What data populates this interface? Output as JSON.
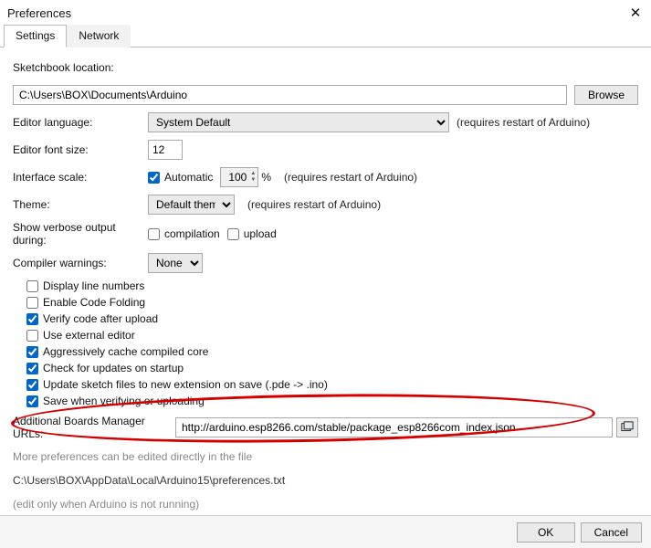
{
  "window": {
    "title": "Preferences"
  },
  "tabs": {
    "settings": "Settings",
    "network": "Network"
  },
  "labels": {
    "sketchbook_location": "Sketchbook location:",
    "editor_language": "Editor language:",
    "editor_font_size": "Editor font size:",
    "interface_scale": "Interface scale:",
    "theme": "Theme:",
    "verbose": "Show verbose output during:",
    "compiler_warnings": "Compiler warnings:",
    "additional_urls": "Additional Boards Manager URLs:",
    "more_prefs": "More preferences can be edited directly in the file",
    "edit_only": "(edit only when Arduino is not running)"
  },
  "values": {
    "sketchbook_path": "C:\\Users\\BOX\\Documents\\Arduino",
    "language": "System Default",
    "font_size": "12",
    "scale_pct": "100",
    "theme": "Default theme",
    "warnings": "None",
    "additional_urls": "http://arduino.esp8266.com/stable/package_esp8266com_index.json",
    "prefs_path": "C:\\Users\\BOX\\AppData\\Local\\Arduino15\\preferences.txt"
  },
  "restart_note": "(requires restart of Arduino)",
  "pct": "%",
  "buttons": {
    "browse": "Browse",
    "ok": "OK",
    "cancel": "Cancel"
  },
  "checks": {
    "automatic": "Automatic",
    "compilation": "compilation",
    "upload": "upload",
    "display_line_numbers": "Display line numbers",
    "enable_code_folding": "Enable Code Folding",
    "verify_after_upload": "Verify code after upload",
    "use_external_editor": "Use external editor",
    "aggressive_cache": "Aggressively cache compiled core",
    "check_updates": "Check for updates on startup",
    "update_sketch_ext": "Update sketch files to new extension on save (.pde -> .ino)",
    "save_when_verifying": "Save when verifying or uploading"
  }
}
